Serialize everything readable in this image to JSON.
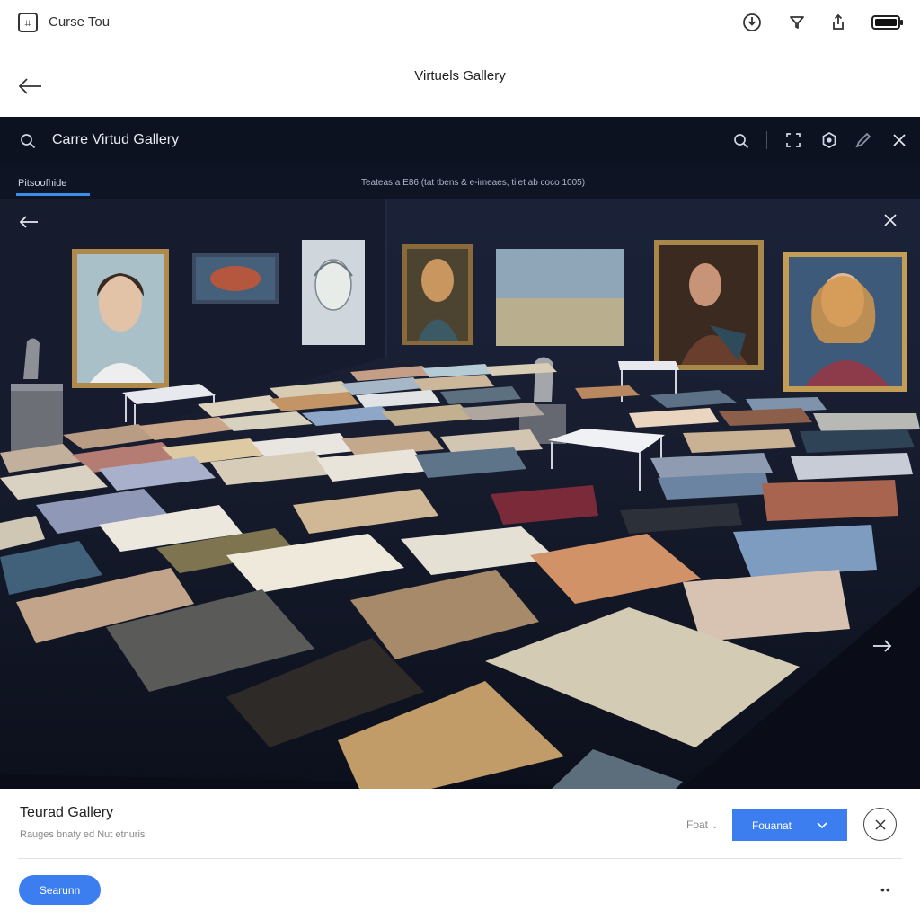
{
  "status_bar": {
    "app_name": "Curse Tou",
    "icons": [
      "download-icon",
      "filter-icon",
      "share-icon",
      "battery-icon"
    ]
  },
  "header": {
    "title": "Virtuels Gallery",
    "back_icon": "arrow-left-icon"
  },
  "viewer": {
    "title": "Carre Virtud Gallery",
    "tab": "Pitsoofhide",
    "status": "Teateas a E86 (tat tbens & e-imeaes, tilet ab coco 1005)",
    "toolbar_icons": [
      "search-icon",
      "fullscreen-icon",
      "settings-icon",
      "edit-icon",
      "close-icon"
    ],
    "nav": {
      "prev": "arrow-left-icon",
      "next": "arrow-right-icon",
      "close": "close-icon"
    },
    "background_color": "#0f1424"
  },
  "sheet": {
    "title": "Teurad Gallery",
    "subtitle": "Rauges bnaty ed Nut etnuris",
    "sort_label": "Foat",
    "primary_button": "Fouanat",
    "search_button": "Searunn",
    "more": "••",
    "accent": "#3c7ef0"
  }
}
